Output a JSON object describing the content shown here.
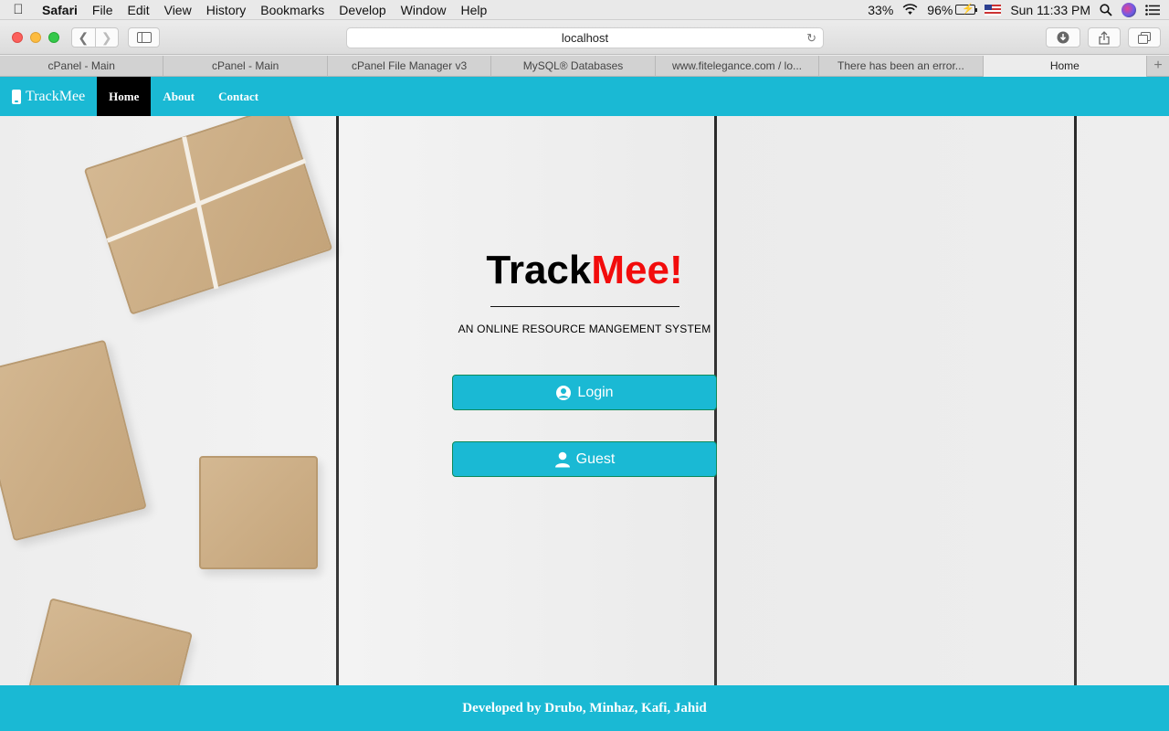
{
  "menubar": {
    "app": "Safari",
    "items": [
      "File",
      "Edit",
      "View",
      "History",
      "Bookmarks",
      "Develop",
      "Window",
      "Help"
    ],
    "status": {
      "brightness": "33%",
      "battery": "96%",
      "clock": "Sun 11:33 PM"
    }
  },
  "browser": {
    "url": "localhost",
    "tabs": [
      {
        "label": "cPanel - Main"
      },
      {
        "label": "cPanel - Main"
      },
      {
        "label": "cPanel File Manager v3"
      },
      {
        "label": "MySQL® Databases"
      },
      {
        "label": "www.fitelegance.com / lo..."
      },
      {
        "label": "There has been an error..."
      },
      {
        "label": "Home"
      }
    ]
  },
  "site": {
    "brand": "TrackMee",
    "nav": [
      {
        "label": "Home"
      },
      {
        "label": "About"
      },
      {
        "label": "Contact"
      }
    ],
    "hero": {
      "title_main": "Track",
      "title_accent": "Mee!",
      "subtitle": "AN ONLINE RESOURCE MANGEMENT SYSTEM"
    },
    "buttons": {
      "login": "Login",
      "guest": "Guest"
    },
    "footer": "Developed by Drubo, Minhaz, Kafi, Jahid"
  },
  "colors": {
    "brand_teal": "#1ab9d4",
    "accent_red": "#f20c0c",
    "nav_active": "#000000"
  },
  "icons": [
    "apple-icon",
    "wifi-icon",
    "battery-icon",
    "flag-icon",
    "search-icon",
    "siri-icon",
    "list-icon",
    "back-icon",
    "forward-icon",
    "sidebar-icon",
    "reload-icon",
    "download-icon",
    "share-icon",
    "tabs-icon",
    "phone-icon",
    "user-circle-icon",
    "user-icon"
  ]
}
